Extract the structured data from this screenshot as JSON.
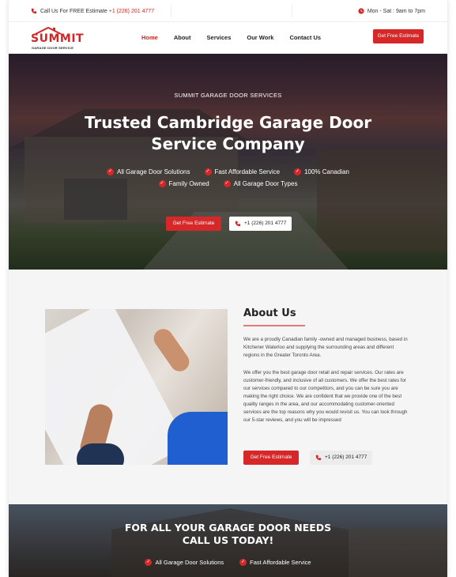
{
  "topbar": {
    "call_label": "Call Us For FREE Estimate",
    "phone": "+1 (226) 201 4777",
    "hours": "Mon - Sat : 9am to 7pm"
  },
  "logo": {
    "name": "SUMMIT",
    "tagline": "GARAGE DOOR SERVICE"
  },
  "nav": {
    "items": [
      "Home",
      "About",
      "Services",
      "Our Work",
      "Contact Us"
    ],
    "active": "Home",
    "cta_label": "Get Free Estimate"
  },
  "hero": {
    "kicker": "SUMMIT GARAGE DOOR SERVICES",
    "title": "Trusted Cambridge Garage Door Service Company",
    "features_row1": [
      "All Garage Door Solutions",
      "Fast Affordable Service",
      "100% Canadian"
    ],
    "features_row2": [
      "Family Owned",
      "All Garage Door Types"
    ],
    "cta_label": "Get Free Estimate",
    "phone": "+1 (226) 201 4777"
  },
  "about": {
    "title": "About Us",
    "paragraph1": "We are a proudly Canadian family -owned and managed business, based in Kitchener Waterloo and supplying the surrounding areas and different regions in the Greater Toronto Area.",
    "paragraph2": "We offer you the best garage door retail and repair services. Our rates are customer-friendly, and inclusive of all customers. We offer the best rates for our services compared to our competitors, and you can be sure you are making the right choice. We are confident that we provide one of the best quality ranges in the area, and our accommodating customer-oriented services are the top reasons why you would revisit us. You can look through our 5-star reviews, and you will be impressed",
    "cta_label": "Get Free Estimate",
    "phone": "+1 (226) 201 4777"
  },
  "banner": {
    "title_line1": "FOR ALL YOUR GARAGE DOOR NEEDS",
    "title_line2": "CALL US TODAY!",
    "features": [
      "All Garage Door Solutions",
      "Fast Affordable Service"
    ]
  },
  "colors": {
    "accent": "#d62828",
    "about_bg": "#f5f5f5"
  }
}
